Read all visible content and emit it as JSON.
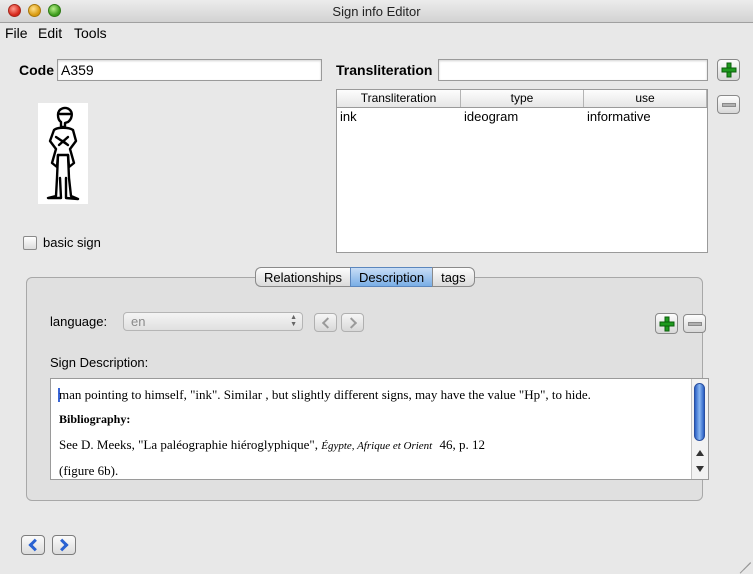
{
  "window": {
    "title": "Sign info Editor"
  },
  "menu": {
    "items": [
      "File",
      "Edit",
      "Tools"
    ]
  },
  "code": {
    "label": "Code",
    "value": "A359"
  },
  "transliteration": {
    "label": "Transliteration",
    "value": ""
  },
  "basic_sign": {
    "label": "basic sign",
    "checked": false
  },
  "table": {
    "columns": [
      "Transliteration",
      "type",
      "use"
    ],
    "rows": [
      {
        "transliteration": "ink",
        "type": "ideogram",
        "use": "informative"
      }
    ]
  },
  "tabs": {
    "items": [
      "Relationships",
      "Description",
      "tags"
    ],
    "active": "Description"
  },
  "language": {
    "label": "language:",
    "value": "en"
  },
  "description": {
    "label": "Sign Description:",
    "line1": "man pointing to himself, \"ink\". Similar , but slightly different signs, may have the value \"Hp\", to hide.",
    "bibliography_heading": "Bibliography:",
    "line3a": "See D. Meeks, \"La paléographie hiéroglyphique\",",
    "line3_journal": "Égypte, Afrique et Orient",
    "line3b": "46, p. 12",
    "line4": "(figure 6b)."
  },
  "icons": {
    "add": "plus-icon",
    "remove": "minus-icon",
    "previous": "chevron-left-icon",
    "next": "chevron-right-icon"
  },
  "colors": {
    "tab_active": "#7aaee6",
    "add_green": "#1f9a1f",
    "nav_blue": "#2a62d2"
  }
}
